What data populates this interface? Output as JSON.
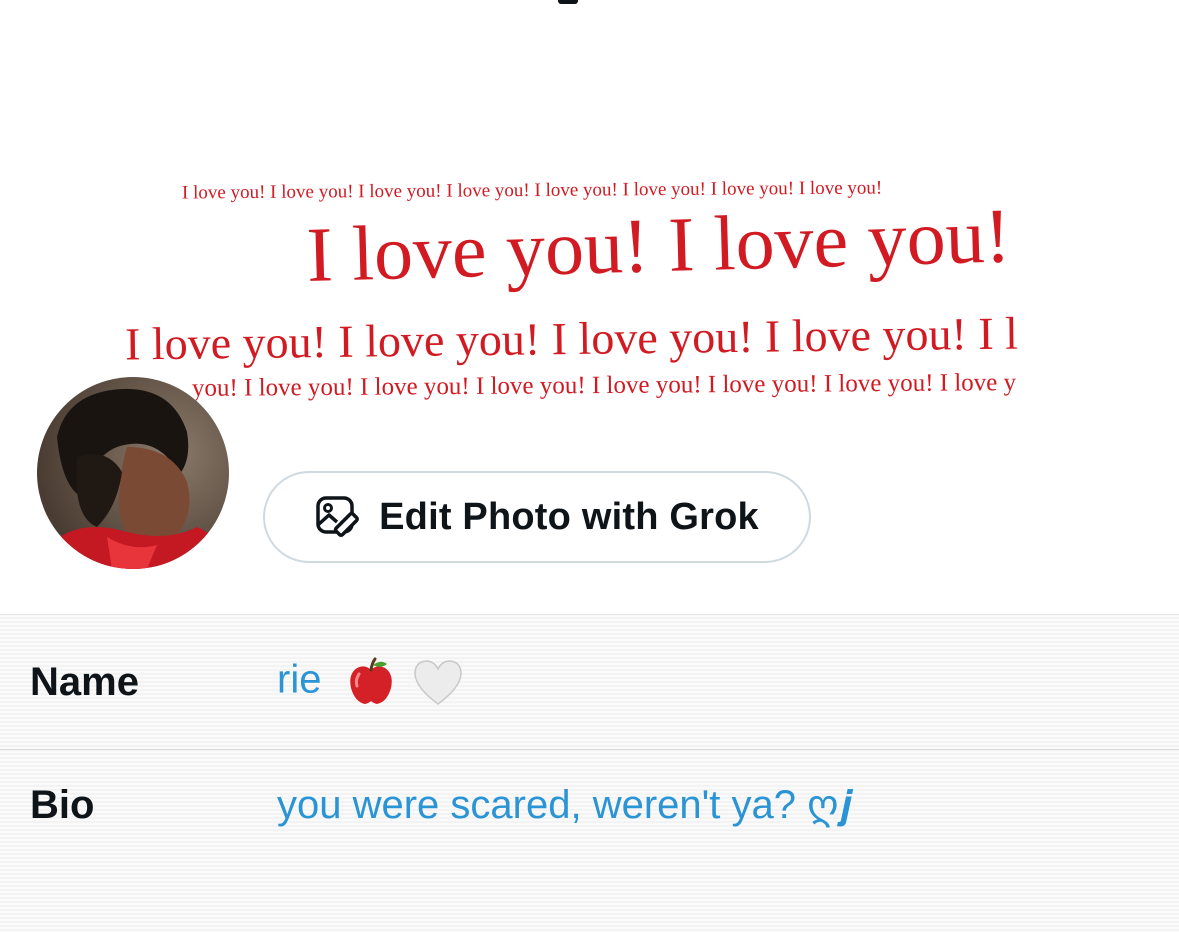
{
  "banner": {
    "line_1": "I love you! I love you! I love you! I love you! I love you! I love you! I love you! I love you!",
    "line_2": "I love you! I love you!",
    "line_3": "I love you! I love you! I love you! I love you! I l",
    "line_4": "you! I love you! I love you! I love you! I love you! I love you! I love you! I love y",
    "text_color": "#d11a22"
  },
  "avatar": {
    "icon": "profile-photo"
  },
  "edit_photo_button": {
    "label": "Edit Photo with Grok",
    "icon": "image-edit-icon"
  },
  "form": {
    "name": {
      "label": "Name",
      "value": "rie",
      "emoji": [
        "red-apple",
        "white-heart"
      ]
    },
    "bio": {
      "label": "Bio",
      "value": "you were scared, weren't ya? ღ𝒋"
    }
  },
  "colors": {
    "accent": "#2b94d4",
    "text": "#0f1419",
    "border": "#cfd9de"
  }
}
